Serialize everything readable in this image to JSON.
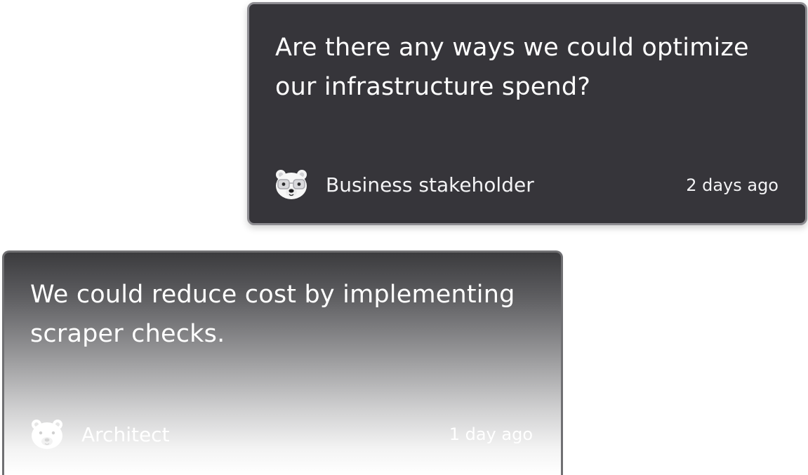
{
  "question_card": {
    "text": "Are there any ways we could optimize our infrastructure spend?",
    "avatar_icon": "polar-bear-with-glasses-icon",
    "author": "Business stakeholder",
    "timestamp": "2 days ago"
  },
  "answer_card": {
    "text": "We could reduce cost by implementing scraper checks.",
    "avatar_icon": "polar-bear-icon",
    "author": "Architect",
    "timestamp": "1 day ago"
  },
  "colors": {
    "card_dark": "#36353a",
    "card_border": "#8e8d92",
    "text": "#ffffff"
  }
}
